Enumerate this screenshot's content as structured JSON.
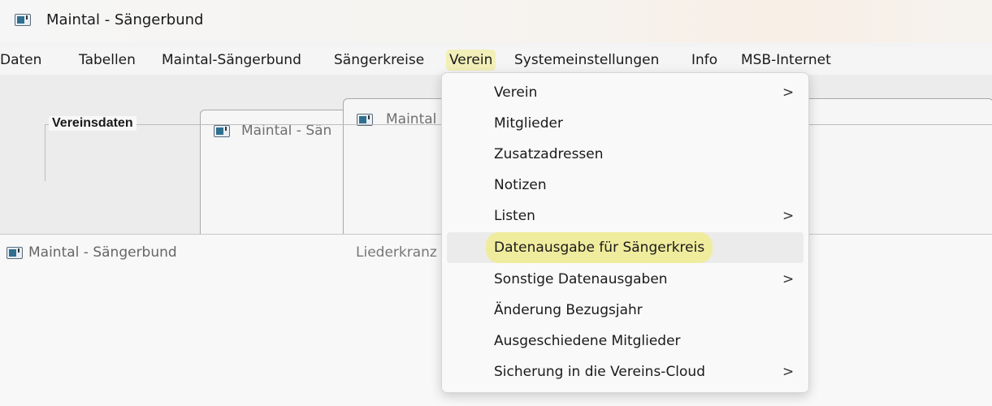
{
  "window": {
    "title": "Maintal - Sängerbund"
  },
  "menubar": {
    "items": [
      {
        "label": "Daten"
      },
      {
        "label": "Tabellen"
      },
      {
        "label": "Maintal-Sängerbund"
      },
      {
        "label": "Sängerkreise"
      },
      {
        "label": "Verein"
      },
      {
        "label": "Systemeinstellungen"
      },
      {
        "label": "Info"
      },
      {
        "label": "MSB-Internet"
      }
    ],
    "open_menu": "Verein"
  },
  "background_windows": {
    "win1_title": "Maintal - Sän",
    "win2_title": "Maintal"
  },
  "main_window": {
    "title": "Maintal - Sängerbund",
    "second_label": "Liederkranz",
    "groupbox_label": "Vereinsdaten"
  },
  "dropdown": {
    "items": [
      {
        "label": "Verein",
        "submenu": true
      },
      {
        "label": "Mitglieder",
        "submenu": false
      },
      {
        "label": "Zusatzadressen",
        "submenu": false
      },
      {
        "label": "Notizen",
        "submenu": false
      },
      {
        "label": "Listen",
        "submenu": true
      },
      {
        "label": "Datenausgabe für Sängerkreis",
        "submenu": false,
        "highlighted": true
      },
      {
        "label": "Sonstige Datenausgaben",
        "submenu": true
      },
      {
        "label": "Änderung Bezugsjahr",
        "submenu": false
      },
      {
        "label": "Ausgeschiedene Mitglieder",
        "submenu": false
      },
      {
        "label": "Sicherung in die Vereins-Cloud",
        "submenu": true
      }
    ],
    "submenu_arrow": ">"
  },
  "colors": {
    "highlight": "#f0ec9e",
    "menu_open": "#f2efb8",
    "icon_block": "#2f6f8f"
  }
}
